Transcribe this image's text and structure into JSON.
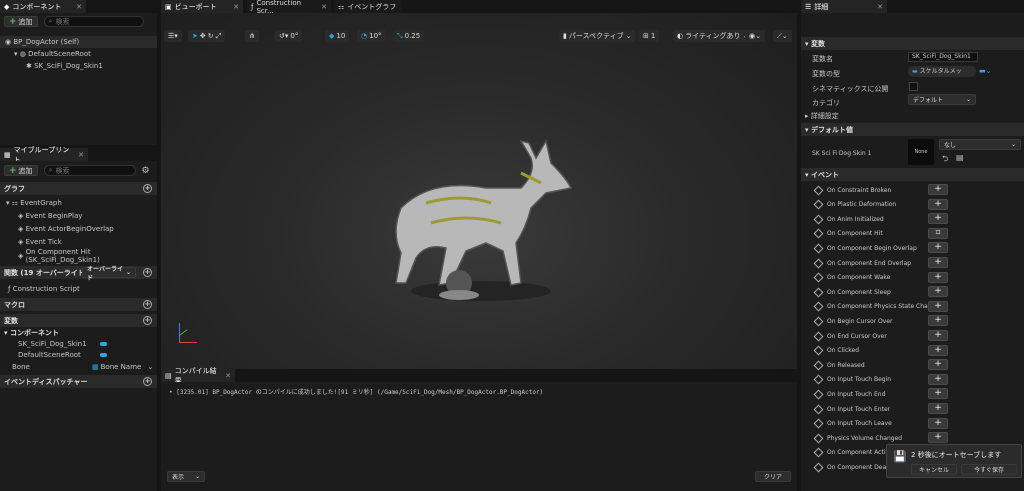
{
  "components_panel": {
    "tab": "コンポーネント",
    "add": "追加",
    "search_placeholder": "検索",
    "root": "BP_DogActor (Self)",
    "scene_root": "DefaultSceneRoot",
    "mesh": "SK_SciFi_Dog_Skin1"
  },
  "blueprint_panel": {
    "tab": "マイブループリント",
    "add": "追加",
    "search_placeholder": "検索",
    "graph": "グラフ",
    "event_graph": "EventGraph",
    "events": [
      "Event BeginPlay",
      "Event ActorBeginOverlap",
      "Event Tick",
      "On Component Hit (SK_SciFi_Dog_Skin1)"
    ],
    "functions": "関数 (19 オーバーライド可",
    "override": "オーバーライド",
    "construction": "Construction Script",
    "macro": "マクロ",
    "variables": "変数",
    "components": "コンポーネント",
    "var_items": [
      "SK_SciFi_Dog_Skin1",
      "DefaultSceneRoot"
    ],
    "bone_label": "Bone",
    "bone_type": "Bone Name",
    "dispatchers": "イベントディスパッチャー"
  },
  "tabs": {
    "viewport": "ビューポート",
    "construction": "Construction Scr...",
    "event_graph": "イベントグラフ"
  },
  "viewport_toolbar": {
    "v1": "0°",
    "v2": "10",
    "v3": "10°",
    "v4": "0.25",
    "perspective": "パースペクティブ",
    "count": "1",
    "lighting": "ライティングあり"
  },
  "compile": {
    "tab": "コンパイル結果",
    "message": "[3235.01] BP_DogActor のコンパイルに成功しました![91 ミリ秒] (/Game/SciFi_Dog/Mesh/BP_DogActor.BP_DogActor)",
    "show": "表示",
    "clear": "クリア"
  },
  "details": {
    "tab": "詳細",
    "variable_section": "変数",
    "var_name_label": "変数名",
    "var_name": "SK_SciFi_Dog_Skin1",
    "var_type_label": "変数の型",
    "var_type": "スケルタルメッ",
    "cinematic_label": "シネマティックスに公開",
    "category_label": "カテゴリ",
    "category": "デフォルト",
    "advanced": "詳細設定",
    "default_section": "デフォルト値",
    "default_label": "SK Sci Fi Dog Skin 1",
    "thumb": "None",
    "none": "なし",
    "event_section": "イベント",
    "events": [
      "On Constraint Broken",
      "On Plastic Deformation",
      "On Anim Initialized",
      "On Component Hit",
      "On Component Begin Overlap",
      "On Component End Overlap",
      "On Component Wake",
      "On Component Sleep",
      "On Component Physics State Change",
      "On Begin Cursor Over",
      "On End Cursor Over",
      "On Clicked",
      "On Released",
      "On Input Touch Begin",
      "On Input Touch End",
      "On Input Touch Enter",
      "On Input Touch Leave",
      "Physics Volume Changed",
      "On Component Activat",
      "On Component Deactiv"
    ]
  },
  "autosave": {
    "message": "2 秒後にオートセーブします",
    "cancel": "キャンセル",
    "save_now": "今すぐ保存"
  },
  "colors": {
    "accent": "#2aa9e0",
    "bg": "#151515",
    "panel": "#1c1c1c",
    "add_green": "#5fbf5f"
  }
}
